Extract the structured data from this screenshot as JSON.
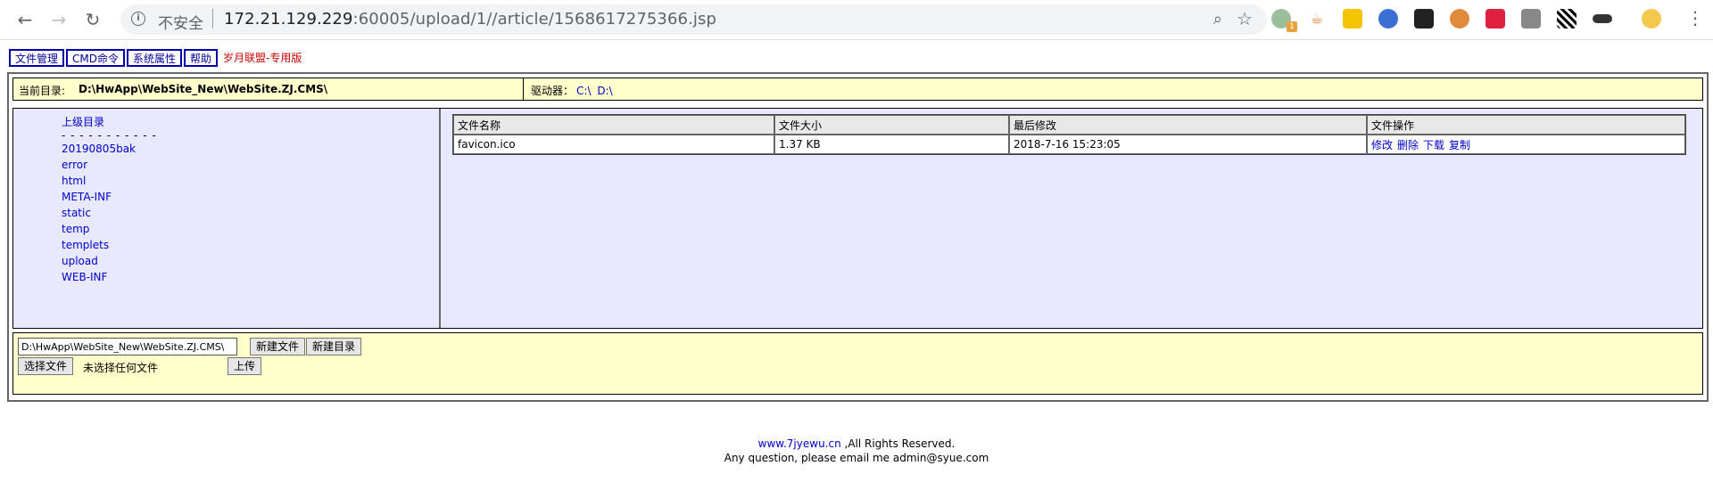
{
  "browser": {
    "security_label": "不安全",
    "url_host": "172.21.129.229",
    "url_rest": ":60005/upload/1//article/1568617275366.jsp",
    "extension_badge": "1"
  },
  "menu": {
    "items": [
      "文件管理",
      "CMD命令",
      "系统属性",
      "帮助"
    ],
    "brand": "岁月联盟-专用版"
  },
  "pathbar": {
    "current_label": "当前目录:",
    "current_path": "D:\\HwApp\\WebSite_New\\WebSite.ZJ.CMS\\",
    "drives_label": "驱动器：",
    "drives": [
      "C:\\",
      "D:\\"
    ]
  },
  "dirs": {
    "parent": "上级目录",
    "separator": "- - - - - - - - - - -",
    "items": [
      "20190805bak",
      "error",
      "html",
      "META-INF",
      "static",
      "temp",
      "templets",
      "upload",
      "WEB-INF"
    ]
  },
  "files": {
    "headers": [
      "文件名称",
      "文件大小",
      "最后修改",
      "文件操作"
    ],
    "rows": [
      {
        "name": "favicon.ico",
        "size": "1.37 KB",
        "modified": "2018-7-16 15:23:05",
        "actions": [
          "修改",
          "删除",
          "下载",
          "复制"
        ]
      }
    ]
  },
  "bottom": {
    "path_value": "D:\\HwApp\\WebSite_New\\WebSite.ZJ.CMS\\",
    "new_file": "新建文件",
    "new_dir": "新建目录",
    "choose_file": "选择文件",
    "no_file": "未选择任何文件",
    "upload": "上传"
  },
  "footer": {
    "site": "www.7jyewu.cn",
    "rights": " ,All Rights Reserved.",
    "contact": "Any question, please email me admin@syue.com"
  }
}
